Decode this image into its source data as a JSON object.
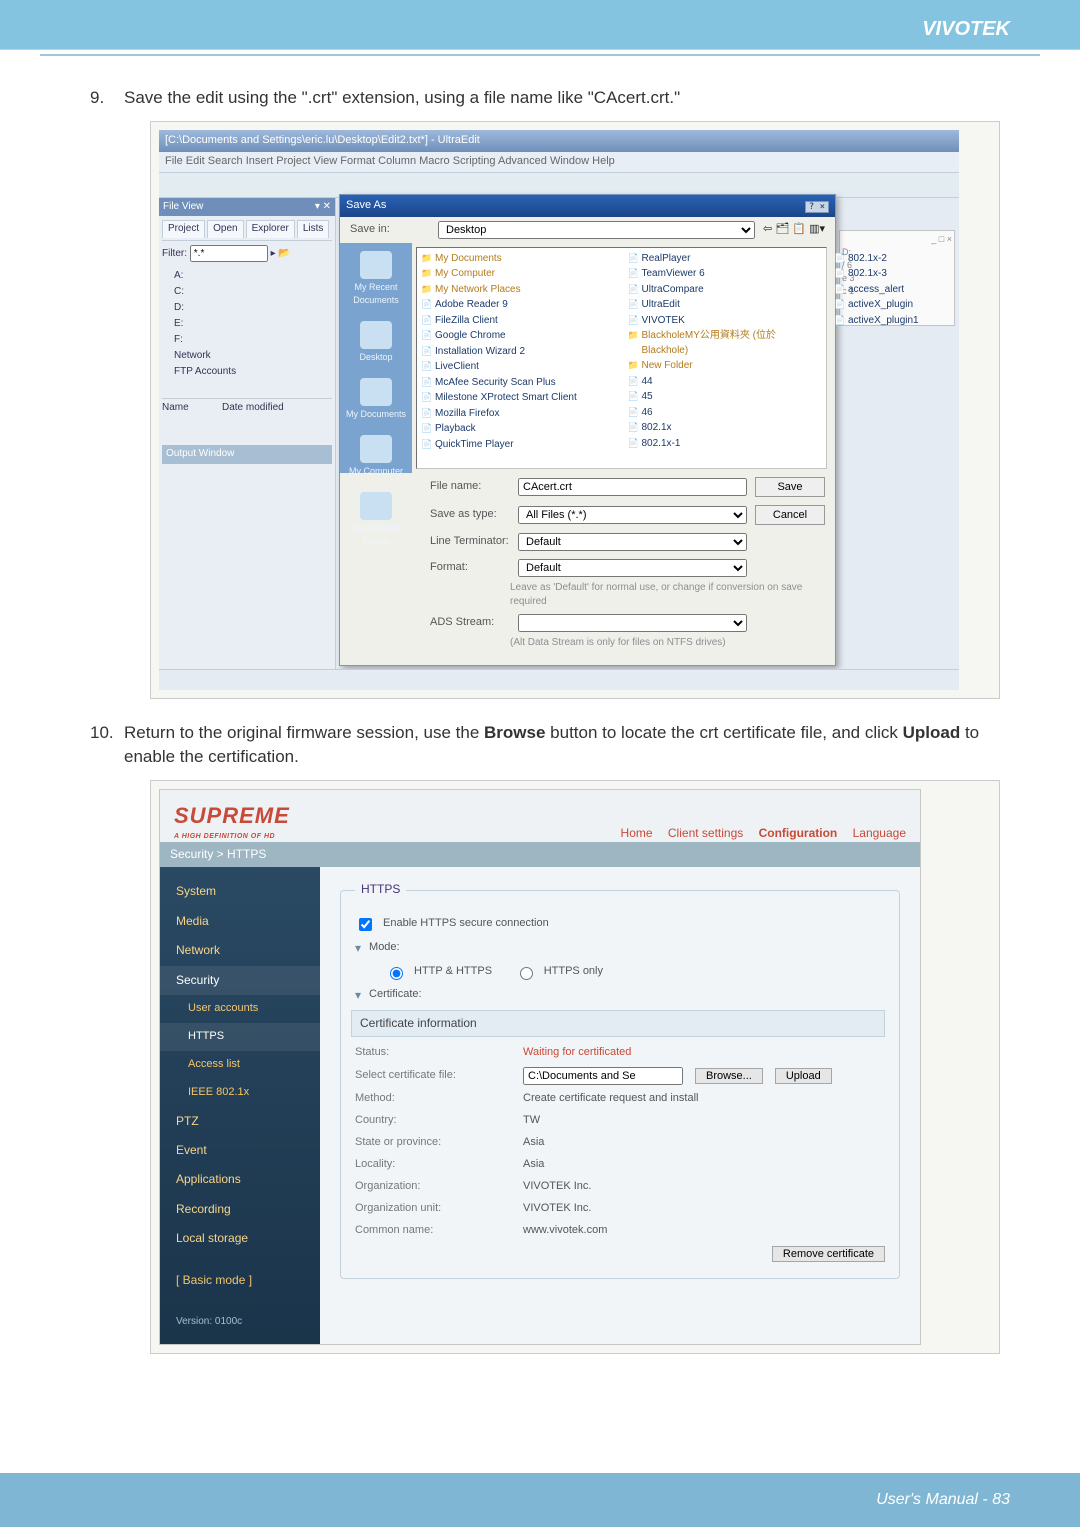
{
  "header": {
    "brand": "VIVOTEK"
  },
  "steps": {
    "s9": {
      "num": "9.",
      "text": "Save the edit using the \".crt\" extension, using a file name like \"CAcert.crt.\""
    },
    "s10": {
      "num": "10.",
      "text_a": "Return to the original firmware session, use the ",
      "bold_a": "Browse",
      "text_b": " button to locate the crt certificate file, and click ",
      "bold_b": "Upload",
      "text_c": " to enable the certification."
    }
  },
  "ultraedit": {
    "titlebar": "[C:\\Documents and Settings\\eric.lu\\Desktop\\Edit2.txt*] - UltraEdit",
    "menubar": "File  Edit  Search  Insert  Project  View  Format  Column  Macro  Scripting  Advanced  Window  Help",
    "filetree_header": "File View",
    "panel_tabs": {
      "project": "Project",
      "open": "Open",
      "explorer": "Explorer",
      "lists": "Lists"
    },
    "filter_label": "Filter:",
    "filter_value": "*.*",
    "drives": [
      "A:",
      "C:",
      "D:",
      "E:",
      "F:",
      "Network",
      "FTP Accounts"
    ],
    "list_headers": {
      "name": "Name",
      "date": "Date modified"
    },
    "output_window": "Output Window",
    "rightstub": {
      "close": "_ □ ×",
      "lines": [
        "D:",
        "/ 6",
        "e 3",
        "c 1"
      ]
    },
    "saveas": {
      "title": "Save As",
      "savein_label": "Save in:",
      "savein_value": "Desktop",
      "places": [
        "My Recent Documents",
        "Desktop",
        "My Documents",
        "My Computer",
        "My Network Places"
      ],
      "files_left": [
        "My Documents",
        "My Computer",
        "My Network Places",
        "Adobe Reader 9",
        "FileZilla Client",
        "Google Chrome",
        "Installation Wizard 2",
        "LiveClient",
        "McAfee Security Scan Plus",
        "Milestone XProtect Smart Client",
        "Mozilla Firefox",
        "Playback",
        "QuickTime Player",
        "RealPlayer",
        "TeamViewer 6"
      ],
      "files_right": [
        "UltraCompare",
        "UltraEdit",
        "VIVOTEK",
        "BlackholeMY公用資料夾 (位於 Blackhole)",
        "New Folder",
        "44",
        "45",
        "46",
        "802.1x",
        "802.1x-1",
        "802.1x-2",
        "802.1x-3",
        "access_alert",
        "activeX_plugin",
        "activeX_plugin1"
      ],
      "filename_label": "File name:",
      "filename_value": "CAcert.crt",
      "savetype_label": "Save as type:",
      "savetype_value": "All Files (*.*)",
      "lineterm_label": "Line Terminator:",
      "lineterm_value": "Default",
      "format_label": "Format:",
      "format_value": "Default",
      "format_note": "Leave as 'Default' for normal use, or change if conversion on save required",
      "ads_label": "ADS Stream:",
      "ads_note": "(Alt Data Stream is only for files on NTFS drives)",
      "save_btn": "Save",
      "cancel_btn": "Cancel",
      "dlg_x": "? ×"
    }
  },
  "firmware": {
    "brand": "SUPREME",
    "brand_sub": "A HIGH DEFINITION OF HD",
    "topnav": {
      "home": "Home",
      "client": "Client settings",
      "config": "Configuration",
      "lang": "Language"
    },
    "crumb": "Security > HTTPS",
    "side": [
      "System",
      "Media",
      "Network",
      "Security"
    ],
    "side_sub": [
      "User accounts",
      "HTTPS",
      "Access list",
      "IEEE 802.1x"
    ],
    "side2": [
      "PTZ",
      "Event",
      "Applications",
      "Recording",
      "Local storage"
    ],
    "basic": "[ Basic mode ]",
    "version": "Version: 0100c",
    "fieldset_legend": "HTTPS",
    "enable_label": "Enable HTTPS secure connection",
    "mode_label": "Mode:",
    "mode_opt1": "HTTP & HTTPS",
    "mode_opt2": "HTTPS only",
    "cert_label": "Certificate:",
    "certinfo_header": "Certificate information",
    "rows": {
      "status_l": "Status:",
      "status_v": "Waiting for certificated",
      "select_l": "Select certificate file:",
      "select_v": "C:\\Documents and Se",
      "method_l": "Method:",
      "method_v": "Create certificate request and install",
      "country_l": "Country:",
      "country_v": "TW",
      "state_l": "State or province:",
      "state_v": "Asia",
      "locality_l": "Locality:",
      "locality_v": "Asia",
      "org_l": "Organization:",
      "org_v": "VIVOTEK Inc.",
      "orgunit_l": "Organization unit:",
      "orgunit_v": "VIVOTEK Inc.",
      "cn_l": "Common name:",
      "cn_v": "www.vivotek.com"
    },
    "btn_browse": "Browse...",
    "btn_upload": "Upload",
    "btn_remove": "Remove certificate"
  },
  "footer": {
    "label": "User's Manual - ",
    "page": "83"
  }
}
